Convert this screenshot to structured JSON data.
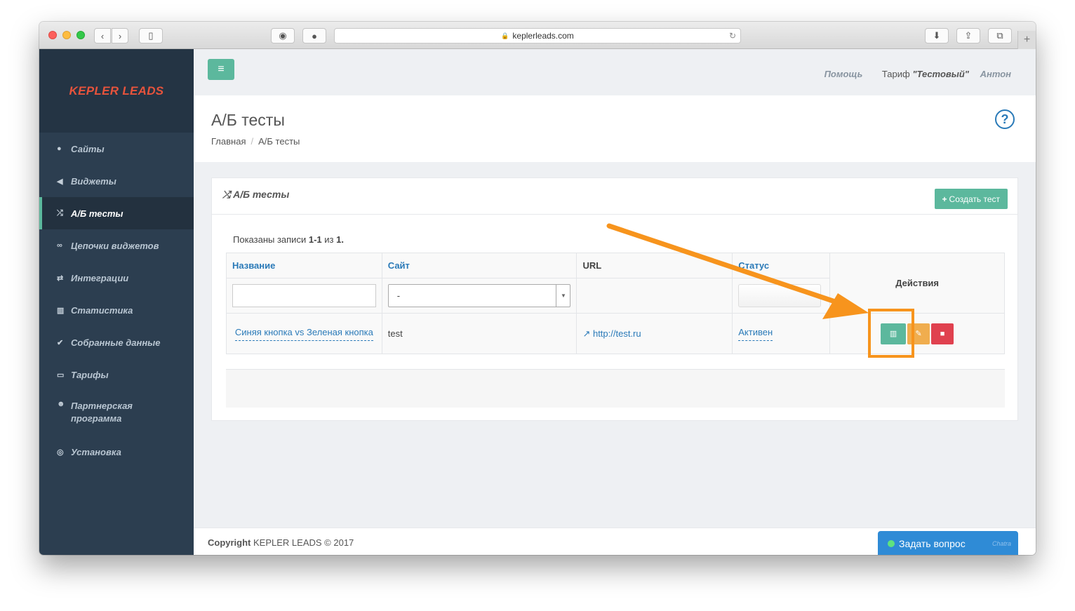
{
  "browser": {
    "url": "keplerleads.com"
  },
  "sidebar": {
    "brand": "KEPLER LEADS",
    "items": [
      {
        "label": "Сайты",
        "icon": "globe-icon",
        "glyph": "●"
      },
      {
        "label": "Виджеты",
        "icon": "bullhorn-icon",
        "glyph": "◀"
      },
      {
        "label": "А/Б тесты",
        "icon": "shuffle-icon",
        "glyph": "⤮",
        "active": true
      },
      {
        "label": "Цепочки виджетов",
        "icon": "link-icon",
        "glyph": "∞"
      },
      {
        "label": "Интеграции",
        "icon": "exchange-icon",
        "glyph": "⇄"
      },
      {
        "label": "Статистика",
        "icon": "bar-chart-icon",
        "glyph": "▥"
      },
      {
        "label": "Собранные данные",
        "icon": "check-icon",
        "glyph": "✔"
      },
      {
        "label": "Тарифы",
        "icon": "credit-card-icon",
        "glyph": "▭"
      },
      {
        "label": "Партнерская программа",
        "icon": "users-icon",
        "glyph": "☻"
      },
      {
        "label": "Установка",
        "icon": "life-ring-icon",
        "glyph": "◎"
      }
    ]
  },
  "topbar": {
    "help": "Помощь",
    "tariff_prefix": "Тариф",
    "tariff_name": "\"Тестовый\"",
    "user": "Антон"
  },
  "page": {
    "title": "А/Б тесты",
    "breadcrumb": [
      "Главная",
      "А/Б тесты"
    ]
  },
  "panel": {
    "title": "А/Б тесты",
    "create_button": "Создать тест",
    "summary_prefix": "Показаны записи",
    "summary_range": "1-1",
    "summary_of": "из",
    "summary_total": "1."
  },
  "table": {
    "headers": {
      "name": "Название",
      "site": "Сайт",
      "url": "URL",
      "status": "Статус",
      "actions": "Действия"
    },
    "filters": {
      "site_selected": "-"
    },
    "rows": [
      {
        "name": "Синяя кнопка vs Зеленая кнопка",
        "site": "test",
        "url": "http://test.ru",
        "status": "Активен"
      }
    ]
  },
  "footer": {
    "copyright_label": "Copyright",
    "copyright_text": "KEPLER LEADS © 2017"
  },
  "chat": {
    "label": "Задать вопрос",
    "brand": "Chatra"
  },
  "colors": {
    "accent_green": "#5cb89d",
    "sidebar_bg": "#2c3e50",
    "brand_red": "#e7533c",
    "link_blue": "#2a7ab8",
    "annotation_orange": "#f7941d",
    "edit_orange": "#f0ad4e",
    "delete_red": "#e0414f"
  }
}
